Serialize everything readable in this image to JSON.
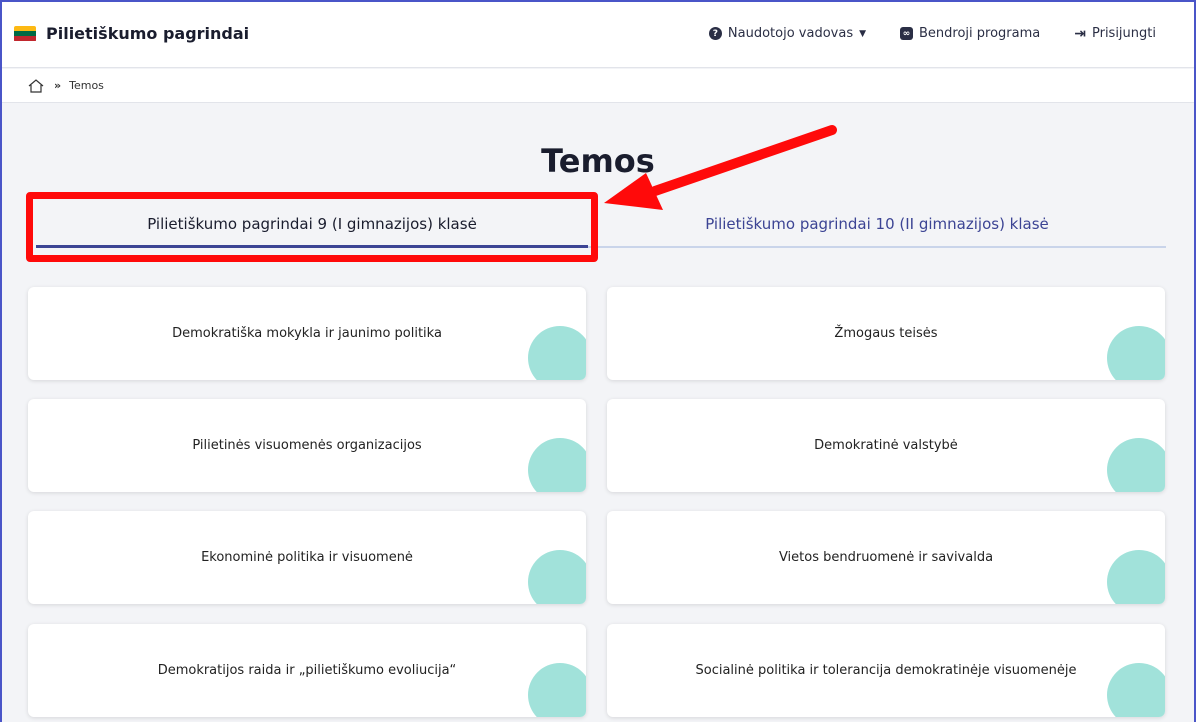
{
  "header": {
    "brand_title": "Pilietiškumo pagrindai",
    "flag_colors": [
      "#fdb913",
      "#006a44",
      "#c1272d"
    ],
    "nav": {
      "guide_label": "Naudotojo vadovas",
      "program_label": "Bendroji programa",
      "login_label": "Prisijungti"
    }
  },
  "breadcrumb": {
    "separator": "»",
    "current": "Temos"
  },
  "page": {
    "title": "Temos"
  },
  "tabs": [
    {
      "label": "Pilietiškumo pagrindai 9 (I gimnazijos) klasė",
      "active": true
    },
    {
      "label": "Pilietiškumo pagrindai 10 (II gimnazijos) klasė",
      "active": false
    }
  ],
  "topics": [
    {
      "label": "Demokratiška mokykla ir jaunimo politika"
    },
    {
      "label": "Žmogaus teisės"
    },
    {
      "label": "Pilietinės visuomenės organizacijos"
    },
    {
      "label": "Demokratinė valstybė"
    },
    {
      "label": "Ekonominė politika ir visuomenė"
    },
    {
      "label": "Vietos bendruomenė ir savivalda"
    },
    {
      "label": "Demokratijos raida ir „pilietiškumo evoliucija“"
    },
    {
      "label": "Socialinė politika ir tolerancija demokratinėje visuomenėje"
    }
  ],
  "colors": {
    "accent": "#3c4494",
    "card_blob": "#a1e2da",
    "annotation": "#ff0a0a"
  }
}
